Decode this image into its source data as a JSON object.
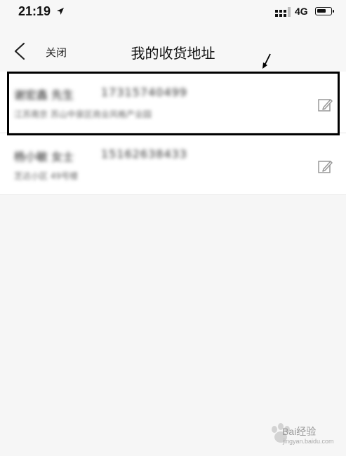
{
  "status_bar": {
    "time": "21:19",
    "network": "4G",
    "icons": [
      "location-arrow-icon",
      "signal-icon",
      "battery-icon"
    ]
  },
  "nav": {
    "back_icon": "chevron-left-icon",
    "close_label": "关闭",
    "title": "我的收货地址"
  },
  "addresses": [
    {
      "name": "谢宏鑫 先生",
      "phone": "17315740499",
      "address": "江苏南京 苏山中泉区商业风格产业园",
      "edit_icon": "edit-icon"
    },
    {
      "name": "杨小敏 女士",
      "phone": "15162638433",
      "address": "芝达小区 49号楼",
      "edit_icon": "edit-icon"
    }
  ],
  "watermark": {
    "text": "Bai经验",
    "url": "jingyan.baidu.com"
  },
  "colors": {
    "background": "#f6f6f6",
    "row_bg": "#ffffff",
    "highlight": "#000000"
  }
}
